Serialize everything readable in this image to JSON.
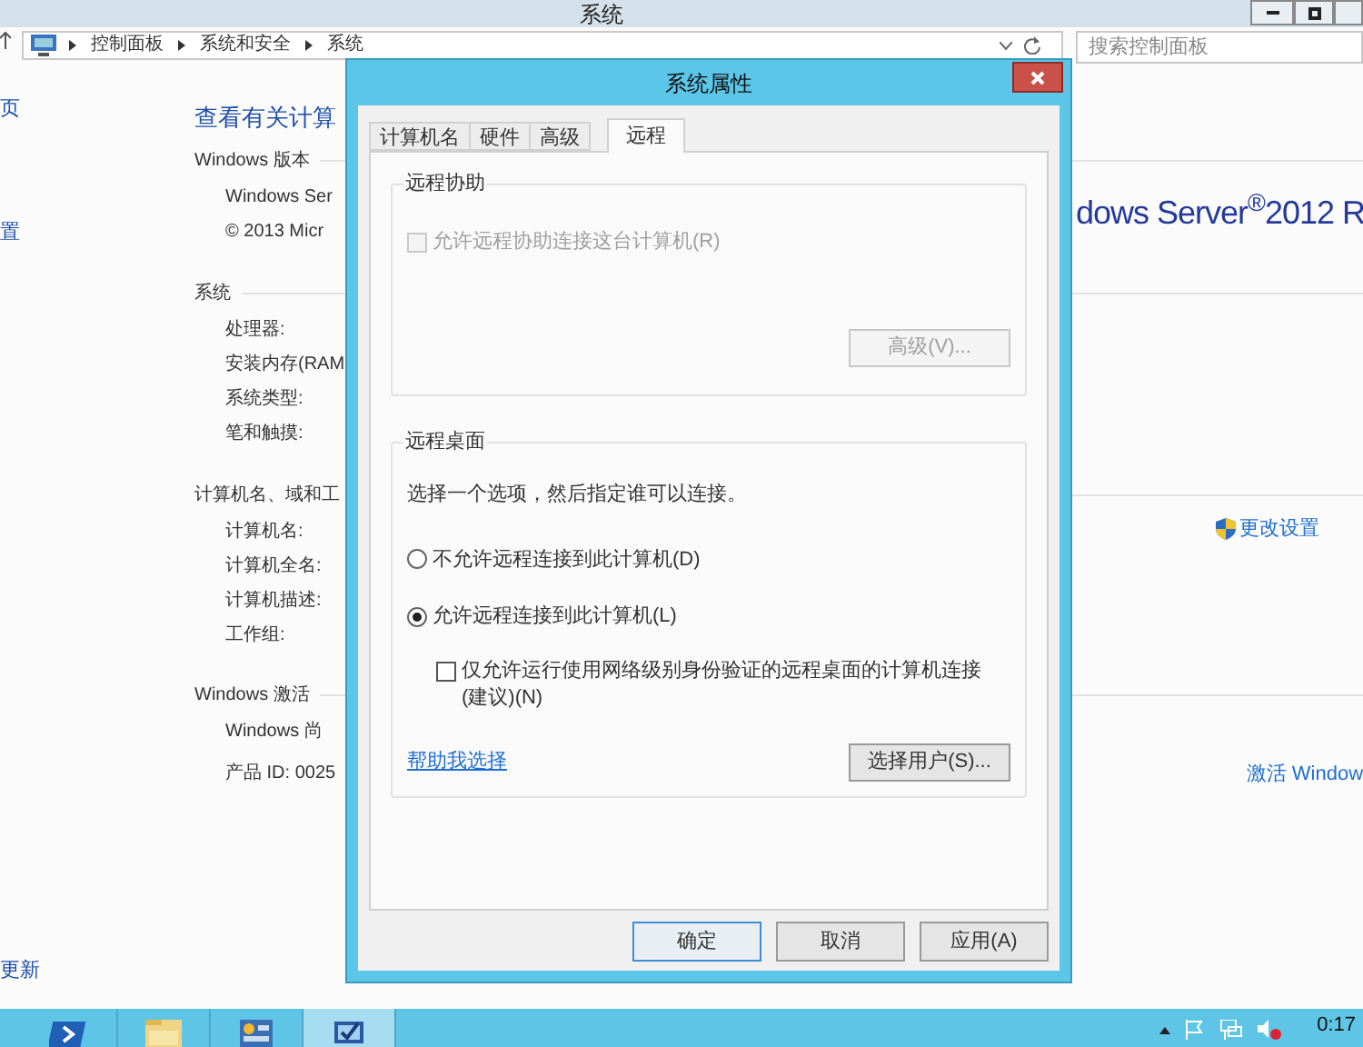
{
  "window": {
    "title": "系统",
    "breadcrumb": [
      "控制面板",
      "系统和安全",
      "系统"
    ],
    "search": {
      "placeholder": "搜索控制面板"
    }
  },
  "sidebar": {
    "items": [
      "页",
      "置",
      "更新"
    ]
  },
  "content": {
    "heading": "查看有关计算",
    "sections": [
      {
        "title": "Windows 版本",
        "rows": [
          "Windows Ser",
          "© 2013 Micr"
        ],
        "aside": {
          "kind": "logo",
          "text": "dows Server$^{®}$2012 R"
        }
      },
      {
        "title": "系统",
        "rows": [
          "处理器:",
          "安装内存(RAM",
          "系统类型:",
          "笔和触摸:"
        ]
      },
      {
        "title": "计算机名、域和工",
        "rows": [
          "计算机名:",
          "计算机全名:",
          "计算机描述:",
          "工作组:"
        ],
        "aside": {
          "kind": "settings_link",
          "text": "更改设置"
        }
      },
      {
        "title": "Windows 激活",
        "rows": [
          "Windows 尚",
          "产品 ID: 0025"
        ],
        "aside": {
          "kind": "activation_link",
          "text": "激活 Window"
        }
      }
    ]
  },
  "dialog": {
    "title": "系统属性",
    "tabs": [
      {
        "label": "计算机名",
        "selected": false
      },
      {
        "label": "硬件",
        "selected": false
      },
      {
        "label": "高级",
        "selected": false
      },
      {
        "label": "远程",
        "selected": true
      }
    ],
    "remote_assistance": {
      "title": "远程协助",
      "checkbox": {
        "label": "允许远程协助连接这台计算机(R)",
        "checked": false,
        "disabled": true
      },
      "button": {
        "label": "高级(V)...",
        "disabled": true
      }
    },
    "remote_desktop": {
      "title": "远程桌面",
      "intro": "选择一个选项，然后指定谁可以连接。",
      "options": [
        {
          "label": "不允许远程连接到此计算机(D)",
          "selected": false
        },
        {
          "label": "允许远程连接到此计算机(L)",
          "selected": true
        }
      ],
      "nla": {
        "label": "仅允许运行使用网络级别身份验证的远程桌面的计算机连接(建议)(N)",
        "checked": false
      },
      "help_link": "帮助我选择",
      "button": "选择用户(S)..."
    },
    "buttons": [
      {
        "label": "确定",
        "default": true
      },
      {
        "label": "取消",
        "default": false
      },
      {
        "label": "应用(A)",
        "default": false
      }
    ]
  },
  "taskbar": {
    "apps": [
      {
        "kind": "powershell",
        "active": false
      },
      {
        "kind": "folder",
        "active": false
      },
      {
        "kind": "server_manager",
        "active": false
      },
      {
        "kind": "remote",
        "active": true
      }
    ],
    "clock": "0:17"
  }
}
